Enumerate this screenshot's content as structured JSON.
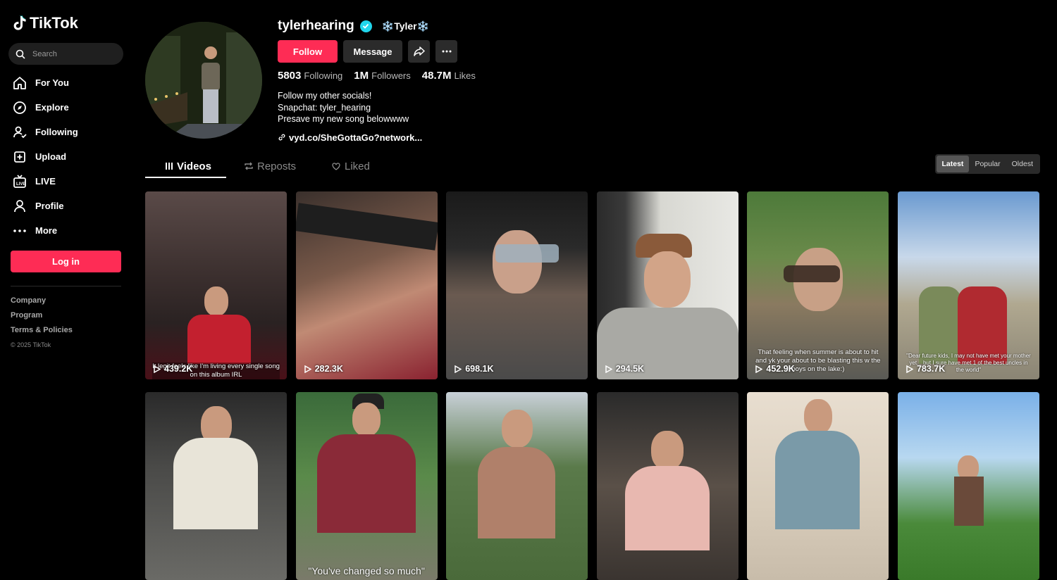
{
  "brand": {
    "name": "TikTok"
  },
  "search": {
    "placeholder": "Search"
  },
  "nav": [
    {
      "label": "For You",
      "icon": "home-icon"
    },
    {
      "label": "Explore",
      "icon": "compass-icon"
    },
    {
      "label": "Following",
      "icon": "following-icon"
    },
    {
      "label": "Upload",
      "icon": "upload-icon"
    },
    {
      "label": "LIVE",
      "icon": "live-icon"
    },
    {
      "label": "Profile",
      "icon": "profile-icon"
    },
    {
      "label": "More",
      "icon": "more-icon"
    }
  ],
  "login_label": "Log in",
  "footer": {
    "links": [
      "Company",
      "Program",
      "Terms & Policies"
    ],
    "copyright": "© 2025 TikTok"
  },
  "profile": {
    "username": "tylerhearing",
    "nickname": "❄️Tyler❄️",
    "follow_label": "Follow",
    "message_label": "Message",
    "following_count": "5803",
    "following_label": "Following",
    "followers_count": "1M",
    "followers_label": "Followers",
    "likes_count": "48.7M",
    "likes_label": "Likes",
    "bio": [
      "Follow my other socials!",
      "Snapchat: tyler_hearing",
      "Presave my new song belowwww"
    ],
    "link": "vyd.co/SheGottaGo?network..."
  },
  "tabs": [
    {
      "label": "Videos",
      "icon": "grid-icon"
    },
    {
      "label": "Reposts",
      "icon": "repost-icon"
    },
    {
      "label": "Liked",
      "icon": "heart-icon"
    }
  ],
  "sort": [
    "Latest",
    "Popular",
    "Oldest"
  ],
  "colors": {
    "accent": "#fe2c55",
    "verified": "#20d5ec",
    "background": "#000000"
  },
  "videos": [
    {
      "views": "439.2K",
      "caption": "It legit feels like I'm living every single song on this album IRL"
    },
    {
      "views": "282.3K",
      "caption": ""
    },
    {
      "views": "698.1K",
      "caption": ""
    },
    {
      "views": "294.5K",
      "caption": ""
    },
    {
      "views": "452.9K",
      "caption": "That feeling when summer is about to hit and yk your about to be blasting this w the boys on the lake:)"
    },
    {
      "views": "783.7K",
      "caption": "\"Dear future kids, I may not have met your mother yet... but I sure have met 1 of the best uncles in the world\""
    },
    {
      "views": "",
      "caption": ""
    },
    {
      "views": "",
      "caption": "\"You've changed so much\""
    },
    {
      "views": "",
      "caption": ""
    },
    {
      "views": "",
      "caption": ""
    },
    {
      "views": "",
      "caption": ""
    },
    {
      "views": "",
      "caption": ""
    }
  ]
}
